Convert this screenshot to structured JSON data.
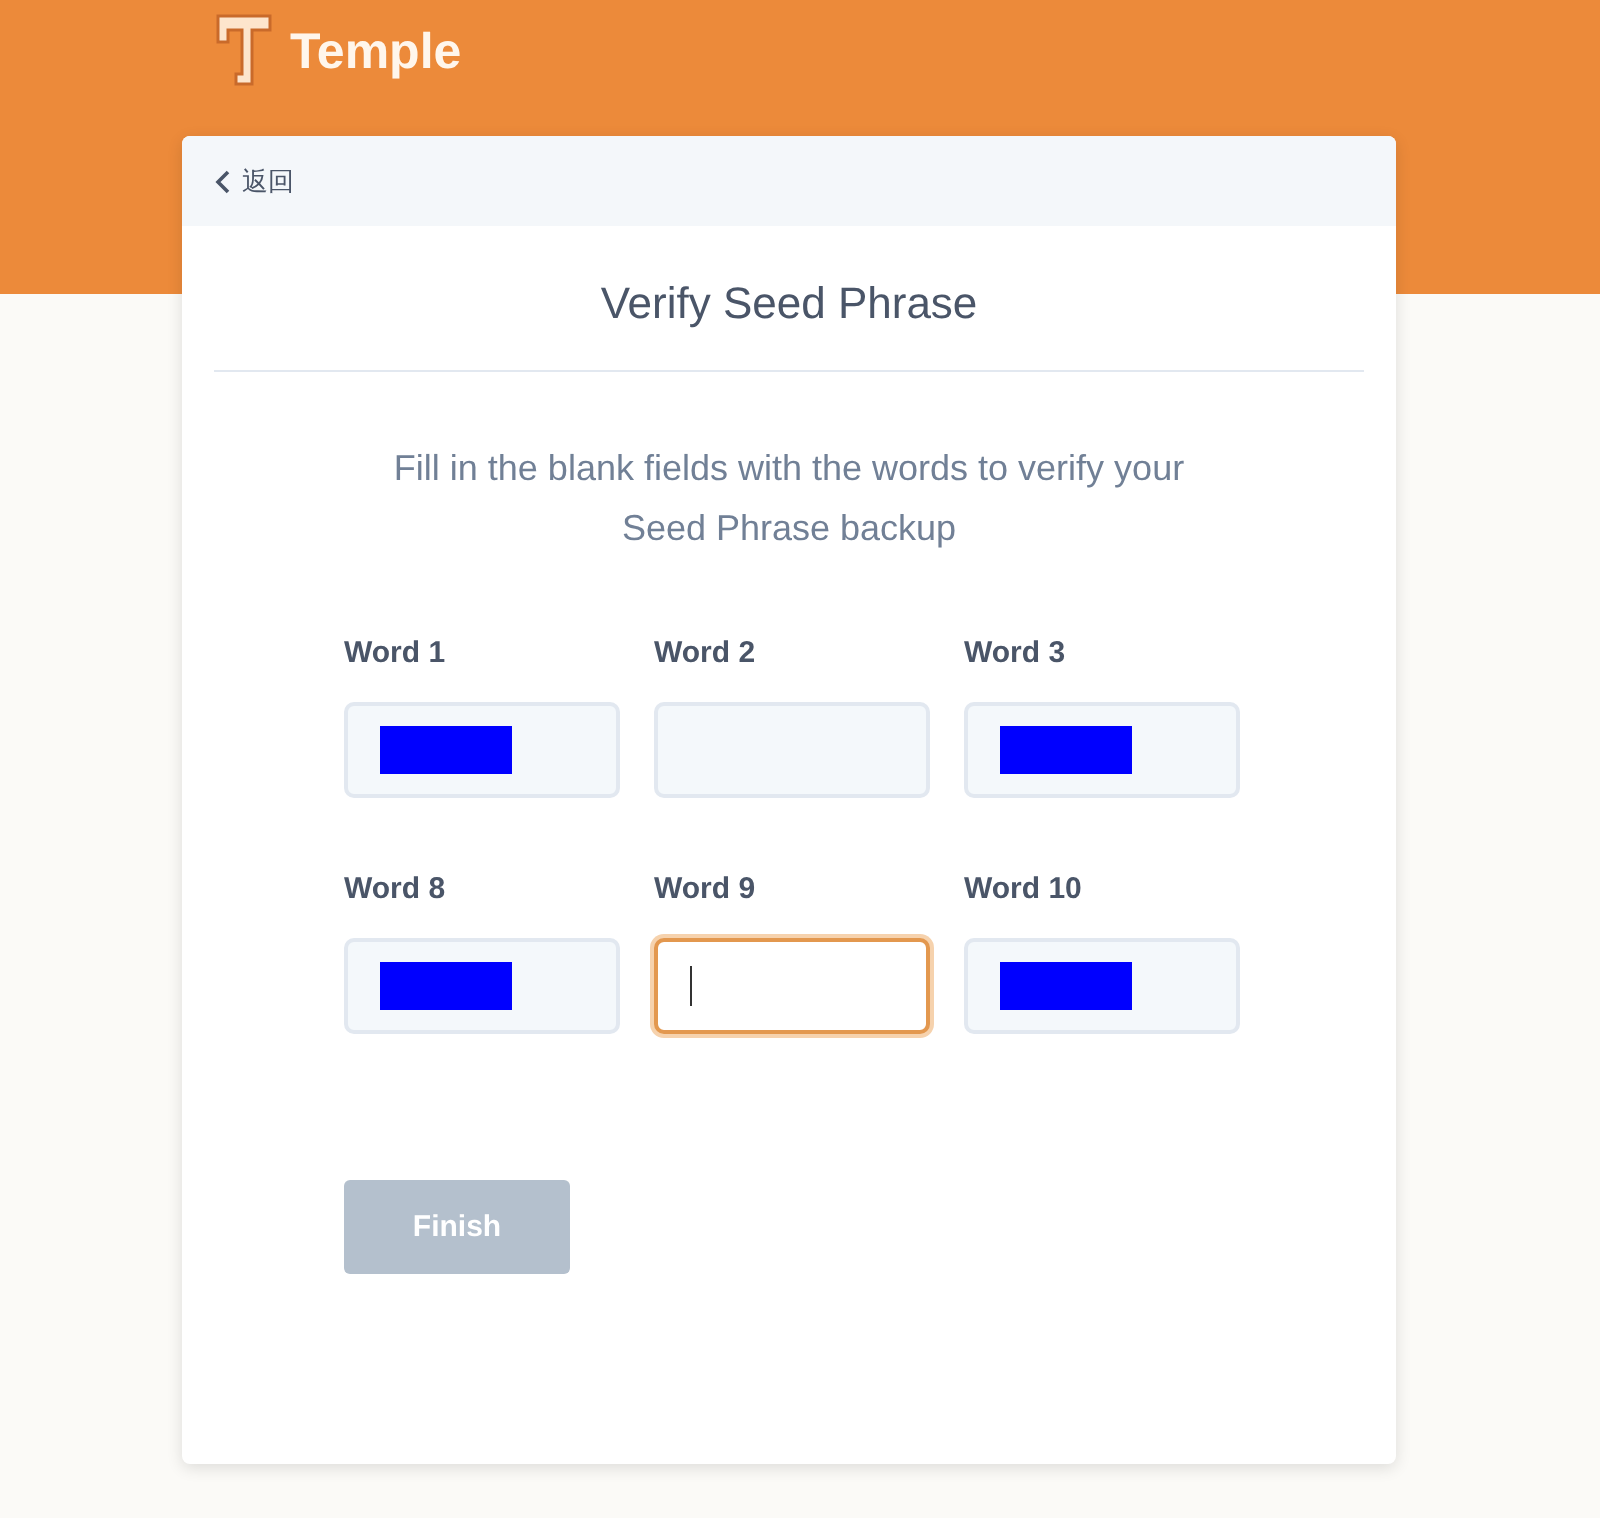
{
  "header": {
    "brand": "Temple"
  },
  "back": {
    "label": "返回"
  },
  "title": "Verify Seed Phrase",
  "description": "Fill in the blank fields with the words to verify your Seed Phrase backup",
  "fields": [
    {
      "label": "Word 1",
      "redacted": true,
      "focused": false
    },
    {
      "label": "Word 2",
      "redacted": false,
      "focused": false
    },
    {
      "label": "Word 3",
      "redacted": true,
      "focused": false
    },
    {
      "label": "Word 8",
      "redacted": true,
      "focused": false
    },
    {
      "label": "Word 9",
      "redacted": false,
      "focused": true
    },
    {
      "label": "Word 10",
      "redacted": true,
      "focused": false
    }
  ],
  "finish": {
    "label": "Finish",
    "disabled": true
  }
}
